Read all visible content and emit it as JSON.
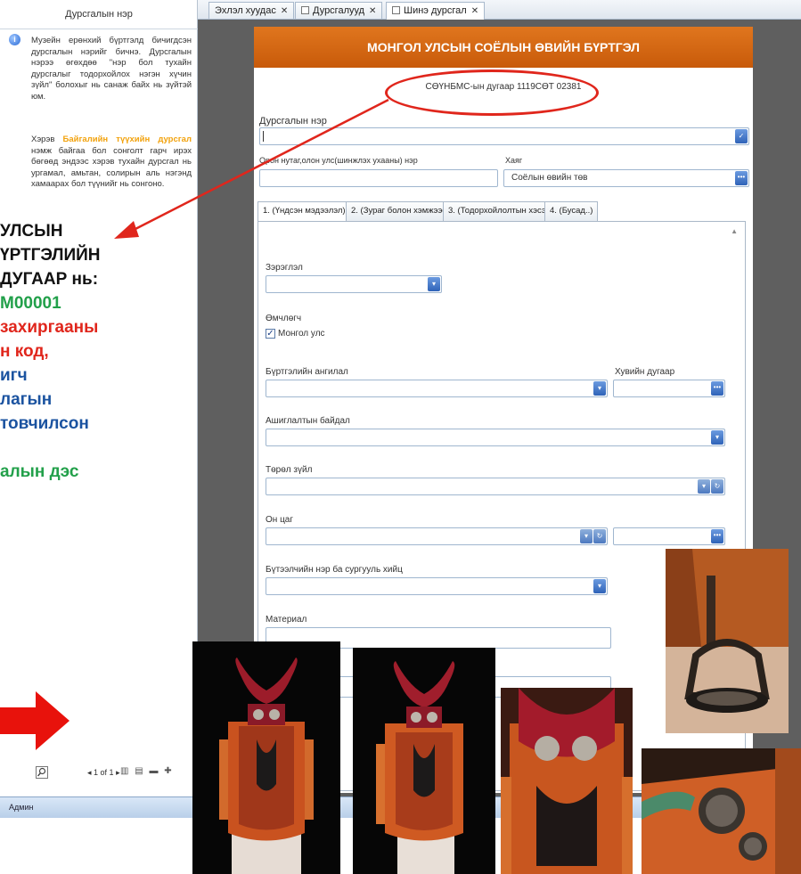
{
  "left_panel": {
    "title": "Дурсгалын нэр",
    "help_paragraph_1": "Музейн ерөнхий бүртгэлд бичигдсэн дурсгалын нэрийг бичнэ. Дурсгалын нэрээ өгөхдөө \"нэр бол тухайн дурсгалыг тодорхойлох нэгэн хүчин зүйл\" болохыг нь санаж байх нь зүйтэй юм.",
    "help_paragraph_2_pre": "Хэрэв",
    "help_paragraph_2_highlight": "Байгалийн түүхийн дурсгал",
    "help_paragraph_2_post": "нэмж байгаа бол сонголт гарч ирэх бөгөөд эндээс хэрэв тухайн дурсгал нь ургамал, амьтан, солирын аль нэгэнд хамаарах бол түүнийг нь сонгоно.",
    "pager_text": "1 of 1",
    "status_user": "Админ"
  },
  "overlay_text": {
    "line1": "УЛСЫН",
    "line2": "ҮРТГЭЛИЙН",
    "line3": "ДУГААР нь:",
    "line4": "M00001",
    "line5": "захиргааны",
    "line6": "н код,",
    "line7": "игч",
    "line8": "лагын",
    "line9": "товчилсон",
    "line10": "алын дэс"
  },
  "tabs": [
    {
      "label": "Эхлэл хуудас"
    },
    {
      "label": "Дурсгалууд"
    },
    {
      "label": "Шинэ дурсгал"
    }
  ],
  "form": {
    "header": "МОНГОЛ УЛСЫН СОЁЛЫН ӨВИЙН БҮРТГЭЛ",
    "reg_number": "СӨҮНБМС-ын дугаар  1119СӨТ 02381",
    "name_label": "Дурсгалын нэр",
    "location_label": "Орон нутаг,олон улс(шинжлэх ухааны) нэр",
    "address_label": "Хаяг",
    "address_value": "Соёлын өвийн төв",
    "subtabs": [
      "1. (Үндсэн мэдээлэл)",
      "2. (Зураг болон хэмжээс)",
      "3. (Тодорхойлолтын хэсэг )",
      "4. (Бусад..)"
    ],
    "status_label": "Зэрэглэл",
    "owner_label": "Өмчлөгч",
    "owner_check": "Монгол улс",
    "reg_category_label": "Бүртгэлийн ангилал",
    "personal_number_label": "Хувийн дугаар",
    "use_status_label": "Ашиглалтын байдал",
    "type_label": "Төрөл зүйл",
    "era_label": "Он цаг",
    "creator_label": "Бүтээлчийн нэр ба сургууль хийц",
    "material_label": "Материал"
  },
  "colors": {
    "header_orange": "#d0650f",
    "annotation_red": "#e0261c",
    "annotation_green": "#22a04a",
    "annotation_blue": "#1b53a0",
    "dropdown_blue": "#3a6fc4"
  }
}
